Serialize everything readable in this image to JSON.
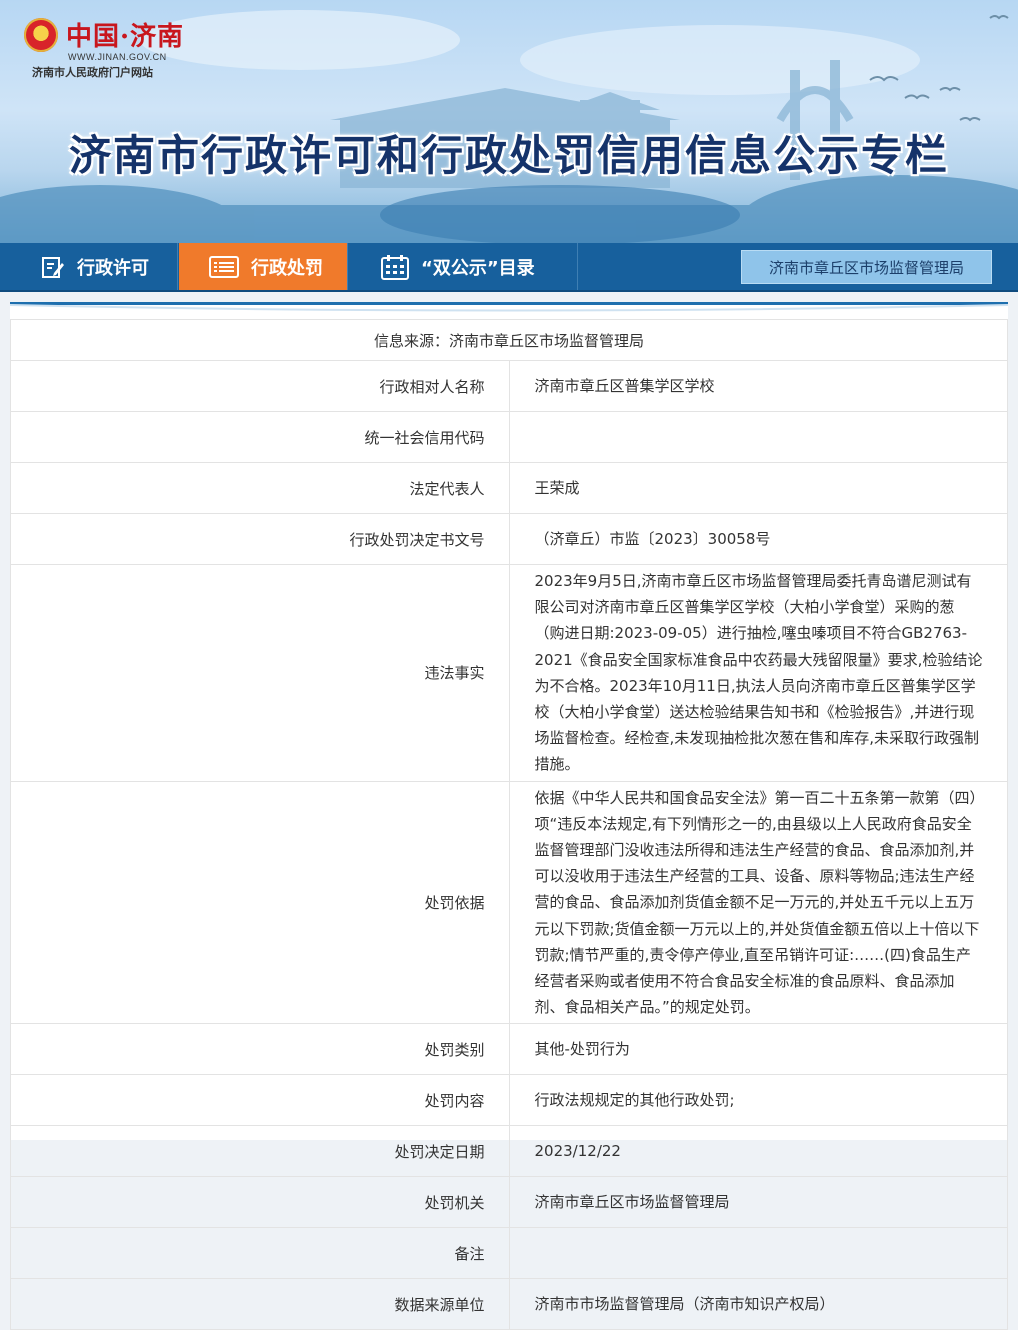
{
  "banner": {
    "logo_text": "中国·济南",
    "logo_domain": "WWW.JINAN.GOV.CN",
    "logo_subtitle": "济南市人民政府门户网站",
    "title": "济南市行政许可和行政处罚信用信息公示专栏"
  },
  "nav": {
    "items": [
      {
        "label": "行政许可",
        "icon": "edit-document-icon"
      },
      {
        "label": "行政处罚",
        "icon": "list-icon"
      },
      {
        "label": "“双公示”目录",
        "icon": "calendar-icon"
      }
    ],
    "active_index": 1,
    "org_button": "济南市章丘区市场监督管理局"
  },
  "record": {
    "source": "信息来源：济南市章丘区市场监督管理局",
    "rows": [
      {
        "label": "行政相对人名称",
        "value": "济南市章丘区普集学区学校"
      },
      {
        "label": "统一社会信用代码",
        "value": ""
      },
      {
        "label": "法定代表人",
        "value": "王荣成"
      },
      {
        "label": "行政处罚决定书文号",
        "value": "（济章丘）市监〔2023〕30058号"
      },
      {
        "label": "违法事实",
        "value": "2023年9月5日,济南市章丘区市场监督管理局委托青岛谱尼测试有限公司对济南市章丘区普集学区学校（大柏小学食堂）采购的葱（购进日期:2023-09-05）进行抽检,噻虫嗪项目不符合GB2763-2021《食品安全国家标准食品中农药最大残留限量》要求,检验结论为不合格。2023年10月11日,执法人员向济南市章丘区普集学区学校（大柏小学食堂）送达检验结果告知书和《检验报告》,并进行现场监督检查。经检查,未发现抽检批次葱在售和库存,未采取行政强制措施。"
      },
      {
        "label": "处罚依据",
        "value": "依据《中华人民共和国食品安全法》第一百二十五条第一款第（四）项“违反本法规定,有下列情形之一的,由县级以上人民政府食品安全监督管理部门没收违法所得和违法生产经营的食品、食品添加剂,并可以没收用于违法生产经营的工具、设备、原料等物品;违法生产经营的食品、食品添加剂货值金额不足一万元的,并处五千元以上五万元以下罚款;货值金额一万元以上的,并处货值金额五倍以上十倍以下罚款;情节严重的,责令停产停业,直至吊销许可证:……(四)食品生产经营者采购或者使用不符合食品安全标准的食品原料、食品添加剂、食品相关产品。”的规定处罚。"
      },
      {
        "label": "处罚类别",
        "value": "其他-处罚行为"
      },
      {
        "label": "处罚内容",
        "value": "行政法规规定的其他行政处罚;"
      },
      {
        "label": "处罚决定日期",
        "value": "2023/12/22"
      },
      {
        "label": "处罚机关",
        "value": "济南市章丘区市场监督管理局"
      },
      {
        "label": "备注",
        "value": ""
      },
      {
        "label": "数据来源单位",
        "value": "济南市市场监督管理局（济南市知识产权局）"
      }
    ]
  },
  "colors": {
    "nav_bg": "#17609d",
    "nav_active": "#f07a2b",
    "title": "#15336a"
  }
}
